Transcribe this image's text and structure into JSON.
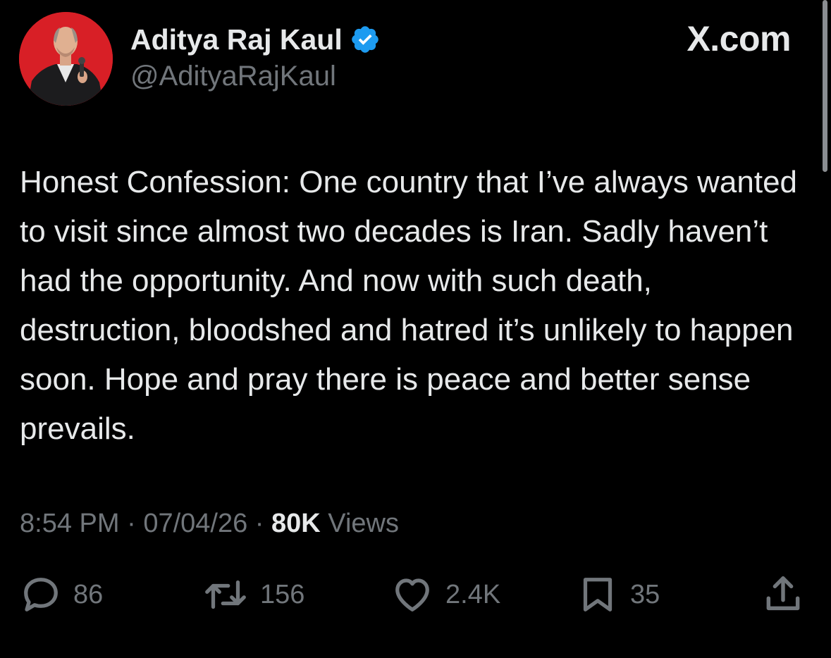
{
  "author": {
    "display_name": "Aditya Raj Kaul",
    "handle": "@AdityaRajKaul",
    "verified": true,
    "avatar_bg": "#d81f26",
    "verified_color": "#1d9bf0"
  },
  "brand": {
    "label": "X.com"
  },
  "tweet": {
    "text": "Honest Confession: One country that I’ve always wanted to visit since almost two decades is Iran. Sadly haven’t had the opportunity. And now with such death, destruction, bloodshed and hatred it’s unlikely to happen soon. Hope and pray there is peace and better sense prevails."
  },
  "meta": {
    "time": "8:54 PM",
    "separator": " · ",
    "date": "07/04/26",
    "views_count": "80K",
    "views_label": " Views"
  },
  "actions": {
    "reply": {
      "icon": "reply-icon",
      "count": "86"
    },
    "repost": {
      "icon": "repost-icon",
      "count": "156"
    },
    "like": {
      "icon": "heart-icon",
      "count": "2.4K"
    },
    "bookmark": {
      "icon": "bookmark-icon",
      "count": "35"
    },
    "share": {
      "icon": "share-icon"
    }
  },
  "colors": {
    "background": "#000000",
    "primary_text": "#e7e9ea",
    "secondary_text": "#71767b"
  }
}
